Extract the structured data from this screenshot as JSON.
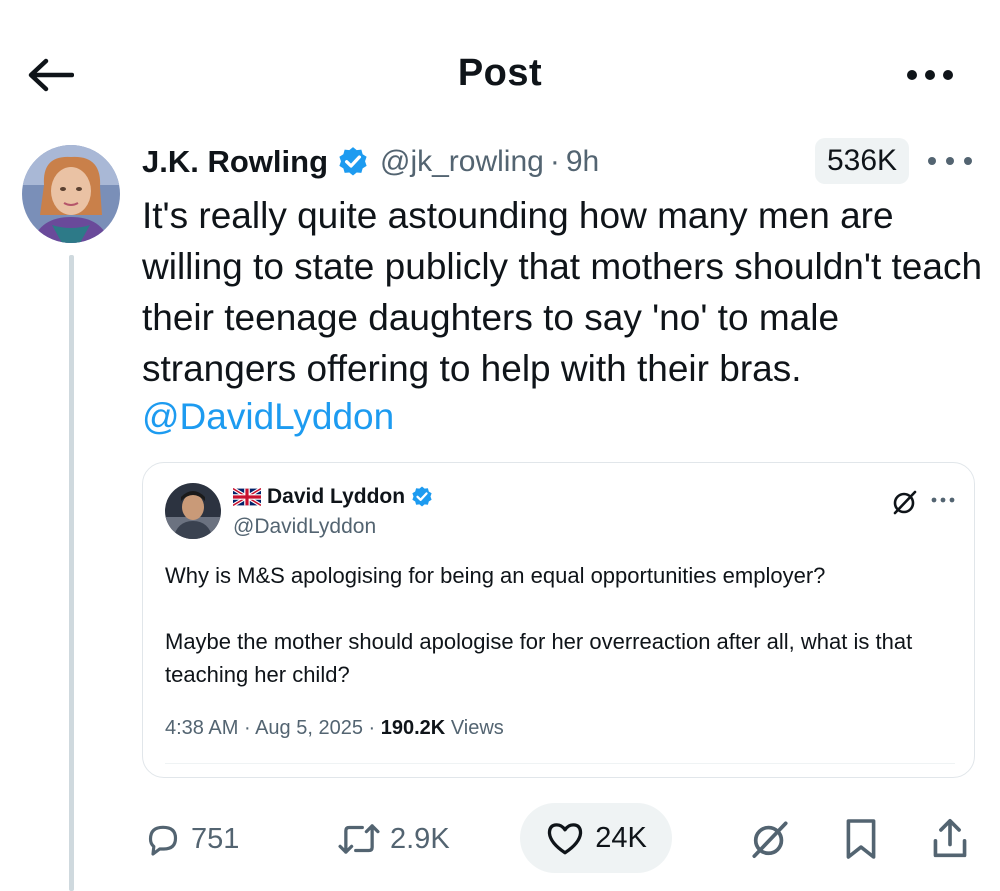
{
  "header": {
    "title": "Post"
  },
  "post": {
    "author_name": "J.K. Rowling",
    "handle": "@jk_rowling",
    "separator": "·",
    "time": "9h",
    "views": "536K",
    "text": "It's really quite astounding how many men are willing to state publicly that mothers shouldn't teach their teenage daughters to say 'no' to male strangers offering to help with their bras.",
    "mention": "@DavidLyddon"
  },
  "quote": {
    "author_name": "David Lyddon",
    "handle": "@DavidLyddon",
    "paragraph1": "Why is M&S apologising for being an equal opportunities employer?",
    "paragraph2": "Maybe the mother should apologise for her overreaction after all, what is that teaching her child?",
    "time": "4:38 AM",
    "sep1": "·",
    "date": "Aug 5, 2025",
    "sep2": "·",
    "views": "190.2K",
    "views_label": "Views"
  },
  "actions": {
    "replies": "751",
    "reposts": "2.9K",
    "likes": "24K"
  },
  "colors": {
    "accent": "#1d9bf0",
    "secondary_text": "#536471",
    "primary_text": "#0f1419",
    "pill_bg": "#eff3f4"
  },
  "icons": [
    "back-arrow-icon",
    "more-icon",
    "verified-badge-icon",
    "grok-icon",
    "reply-icon",
    "repost-icon",
    "like-icon",
    "bookmark-icon",
    "share-icon",
    "uk-flag-icon"
  ]
}
